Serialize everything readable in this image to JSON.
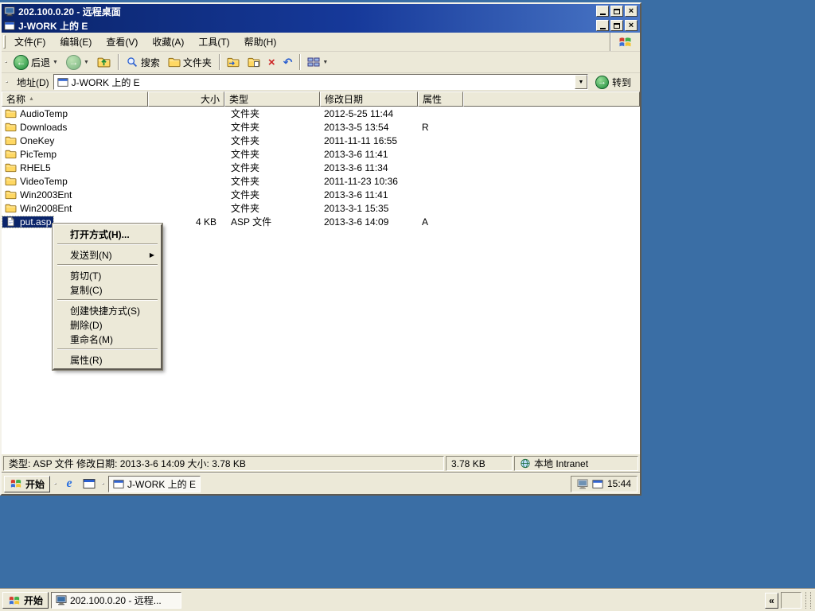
{
  "colors": {
    "desktop": "#3a6ea5",
    "chrome": "#ece9d8",
    "selection": "#0a246a",
    "titlebar_dark": "#0a246a",
    "titlebar_light": "#4a77c6"
  },
  "glyphs": {
    "dropdown": "▼",
    "submenu": "▶",
    "sort_asc": "▲",
    "close": "×",
    "back_arrow": "←",
    "forward_arrow": "→",
    "go_arrow": "→",
    "delete": "×",
    "undo": "↶",
    "chevron": "«",
    "ie": "e"
  },
  "rdp": {
    "title": "202.100.0.20 - 远程桌面"
  },
  "explorer": {
    "title": "J-WORK 上的 E",
    "menu": [
      "文件(F)",
      "编辑(E)",
      "查看(V)",
      "收藏(A)",
      "工具(T)",
      "帮助(H)"
    ],
    "toolbar": {
      "back": "后退",
      "search": "搜索",
      "folders": "文件夹"
    },
    "address": {
      "label": "地址(D)",
      "value": "J-WORK 上的 E",
      "go": "转到"
    },
    "columns": [
      "名称",
      "大小",
      "类型",
      "修改日期",
      "属性"
    ],
    "files": [
      {
        "name": "AudioTemp",
        "size": "",
        "type": "文件夹",
        "modified": "2012-5-25 11:44",
        "attributes": ""
      },
      {
        "name": "Downloads",
        "size": "",
        "type": "文件夹",
        "modified": "2013-3-5 13:54",
        "attributes": "R"
      },
      {
        "name": "OneKey",
        "size": "",
        "type": "文件夹",
        "modified": "2011-11-11 16:55",
        "attributes": ""
      },
      {
        "name": "PicTemp",
        "size": "",
        "type": "文件夹",
        "modified": "2013-3-6 11:41",
        "attributes": ""
      },
      {
        "name": "RHEL5",
        "size": "",
        "type": "文件夹",
        "modified": "2013-3-6 11:34",
        "attributes": ""
      },
      {
        "name": "VideoTemp",
        "size": "",
        "type": "文件夹",
        "modified": "2011-11-23 10:36",
        "attributes": ""
      },
      {
        "name": "Win2003Ent",
        "size": "",
        "type": "文件夹",
        "modified": "2013-3-6 11:41",
        "attributes": ""
      },
      {
        "name": "Win2008Ent",
        "size": "",
        "type": "文件夹",
        "modified": "2013-3-1 15:35",
        "attributes": ""
      },
      {
        "name": "put.asp",
        "size": "4 KB",
        "type": "ASP 文件",
        "modified": "2013-3-6 14:09",
        "attributes": "A"
      }
    ],
    "status": {
      "info": "类型: ASP 文件 修改日期: 2013-3-6 14:09 大小: 3.78 KB",
      "size": "3.78 KB",
      "zone": "本地 Intranet"
    }
  },
  "context_menu": {
    "items": [
      {
        "label": "打开方式(H)..."
      },
      {
        "label": "发送到(N)"
      },
      {
        "label": "剪切(T)"
      },
      {
        "label": "复制(C)"
      },
      {
        "label": "创建快捷方式(S)"
      },
      {
        "label": "删除(D)"
      },
      {
        "label": "重命名(M)"
      },
      {
        "label": "属性(R)"
      }
    ]
  },
  "remote_taskbar": {
    "start": "开始",
    "task": "J-WORK 上的 E",
    "time": "15:44"
  },
  "host_taskbar": {
    "start": "开始",
    "task": "202.100.0.20 - 远程..."
  }
}
